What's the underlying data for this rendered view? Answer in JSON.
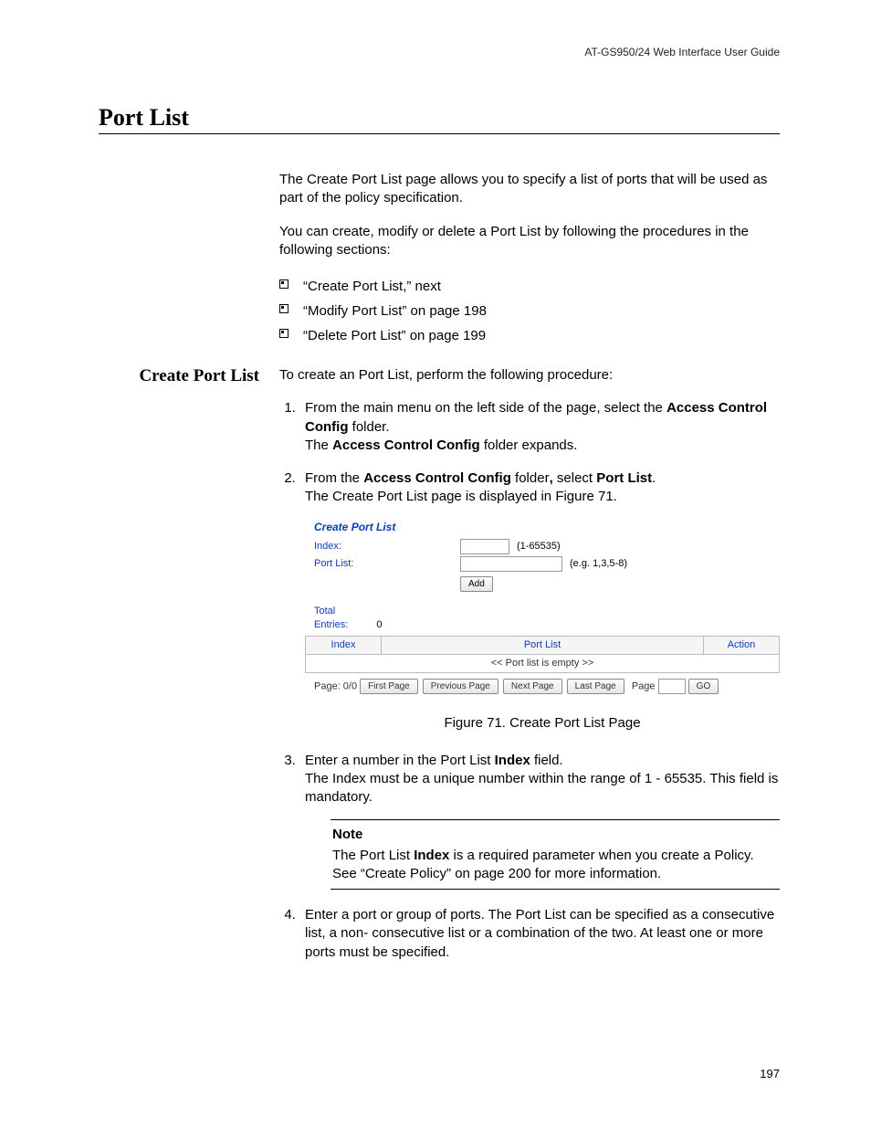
{
  "header": {
    "right": "AT-GS950/24  Web Interface User Guide"
  },
  "title": "Port List",
  "intro": [
    "The Create Port List page allows you to specify a list of ports that will be used as part of the policy specification.",
    "You can create, modify or delete a Port List by following the procedures in the following sections:"
  ],
  "bullets": [
    "“Create Port List,”  next",
    "“Modify Port List” on page 198",
    "“Delete Port List” on page 199"
  ],
  "subhead": "Create Port List",
  "sub_intro": "To create an Port List, perform the following procedure:",
  "steps": {
    "s1_a": "From the main menu on the left side of the page, select the ",
    "s1_b": "Access Control Config",
    "s1_c": " folder.",
    "s1_d": "The ",
    "s1_e": "Access Control Config",
    "s1_f": " folder expands.",
    "s2_a": "From the ",
    "s2_b": "Access Control Config",
    "s2_c": " folder",
    "s2_comma": ",",
    "s2_d": " select ",
    "s2_e": "Port List",
    "s2_f": ".",
    "s2_g": "The Create Port List page is displayed in Figure 71.",
    "s3_a": "Enter a number in the Port List ",
    "s3_b": "Index",
    "s3_c": " field.",
    "s3_d": "The Index must be a unique number within the range of 1 - 65535. This field is mandatory.",
    "s4": "Enter a port or group of ports. The Port List can be specified as a consecutive list, a non- consecutive list or a combination of the two. At least one or more ports must be specified."
  },
  "figure": {
    "title": "Create Port List",
    "index_label": "Index:",
    "index_hint": "(1-65535)",
    "portlist_label": "Port List:",
    "portlist_hint": "(e.g. 1,3,5-8)",
    "add_btn": "Add",
    "total_label": "Total Entries:",
    "total_value": "0",
    "cols": {
      "c1": "Index",
      "c2": "Port List",
      "c3": "Action"
    },
    "empty_row": "<< Port list is empty >>",
    "pager_label": "Page: 0/0",
    "btn_first": "First Page",
    "btn_prev": "Previous Page",
    "btn_next": "Next Page",
    "btn_last": "Last Page",
    "page_word": "Page",
    "btn_go": "GO",
    "caption": "Figure 71. Create Port List Page"
  },
  "note": {
    "label": "Note",
    "t1": "The Port List ",
    "t2": "Index",
    "t3": " is a required parameter when you create a Policy. See “Create Policy” on page 200 for more information."
  },
  "page_number": "197"
}
